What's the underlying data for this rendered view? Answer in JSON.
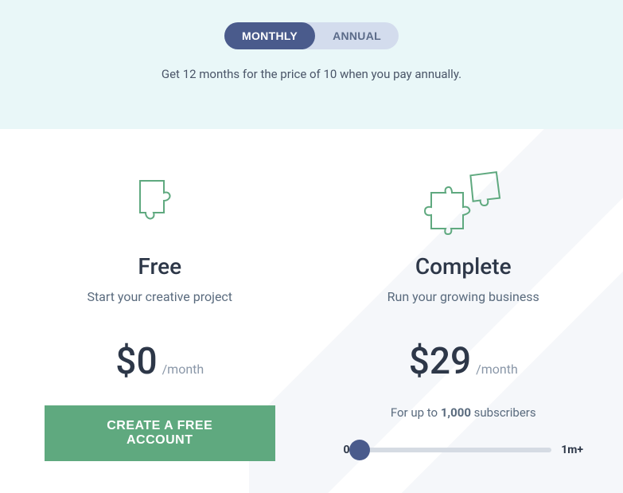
{
  "toggle": {
    "monthly": "MONTHLY",
    "annual": "ANNUAL"
  },
  "hero": {
    "subtitle": "Get 12 months for the price of 10 when you pay annually."
  },
  "plans": {
    "free": {
      "title": "Free",
      "description": "Start your creative project",
      "price": "$0",
      "period": "/month",
      "cta": "CREATE A FREE ACCOUNT"
    },
    "complete": {
      "title": "Complete",
      "description": "Run your growing business",
      "price": "$29",
      "period": "/month",
      "sub_prefix": "For up to ",
      "sub_count": "1,000",
      "sub_suffix": " subscribers",
      "slider_min": "0",
      "slider_max": "1m+"
    }
  }
}
